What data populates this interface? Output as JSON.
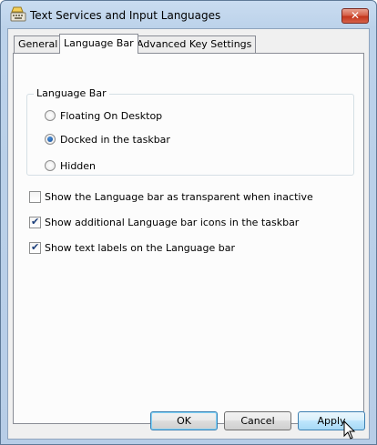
{
  "window": {
    "title": "Text Services and Input Languages",
    "close_label": "✕"
  },
  "tabs": [
    {
      "label": "General",
      "active": false
    },
    {
      "label": "Language Bar",
      "active": true
    },
    {
      "label": "Advanced Key Settings",
      "active": false
    }
  ],
  "language_bar_group": {
    "label": "Language Bar",
    "options": [
      {
        "label": "Floating On Desktop",
        "selected": false
      },
      {
        "label": "Docked in the taskbar",
        "selected": true
      },
      {
        "label": "Hidden",
        "selected": false
      }
    ]
  },
  "checkboxes": [
    {
      "label": "Show the Language bar as transparent when inactive",
      "checked": false
    },
    {
      "label": "Show additional Language bar icons in the taskbar",
      "checked": true
    },
    {
      "label": "Show text labels on the Language bar",
      "checked": true
    }
  ],
  "buttons": {
    "ok": "OK",
    "cancel": "Cancel",
    "apply": "Apply"
  },
  "icons": {
    "app": "keyboard-language-icon",
    "cursor": "mouse-pointer-icon"
  }
}
